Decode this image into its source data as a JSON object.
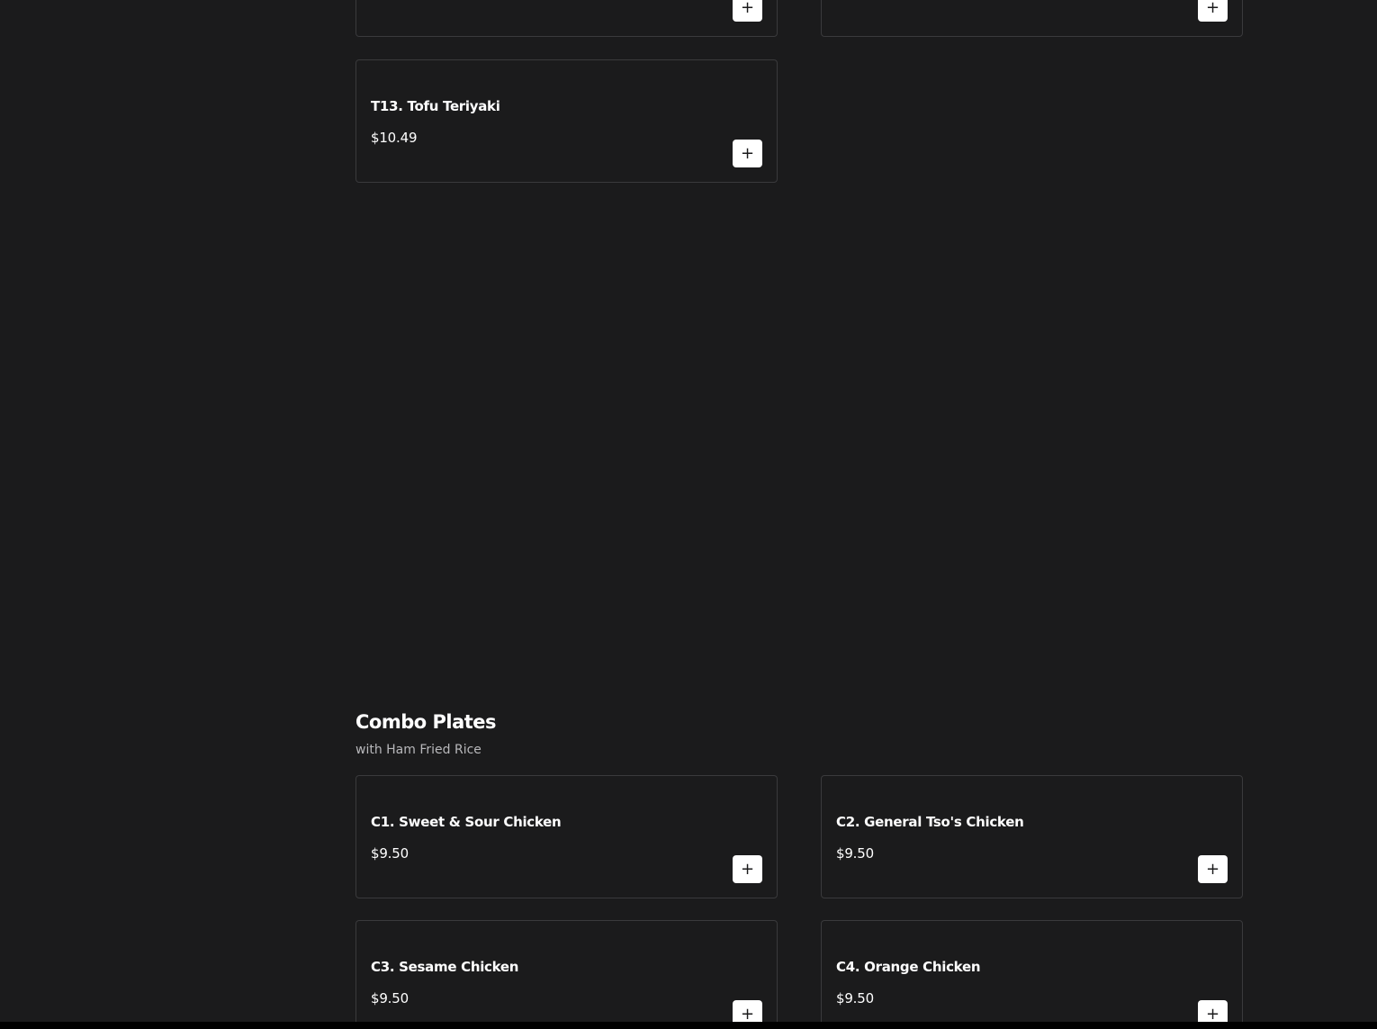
{
  "top_section": {
    "items": [
      {
        "name": "",
        "price": "",
        "add_icon": "plus-icon",
        "add_label": "+"
      },
      {
        "name": "",
        "price": "",
        "add_icon": "plus-icon",
        "add_label": "+"
      },
      {
        "name": "T13. Tofu Teriyaki",
        "price": "$10.49",
        "add_icon": "plus-icon",
        "add_label": "+"
      }
    ]
  },
  "combo_section": {
    "title": "Combo Plates",
    "subtitle": "with Ham Fried Rice",
    "items": [
      {
        "name": "C1. Sweet & Sour Chicken",
        "price": "$9.50",
        "add_icon": "plus-icon",
        "add_label": "+"
      },
      {
        "name": "C2. General Tso's Chicken",
        "price": "$9.50",
        "add_icon": "plus-icon",
        "add_label": "+"
      },
      {
        "name": "C3. Sesame Chicken",
        "price": "$9.50",
        "add_icon": "plus-icon",
        "add_label": "+"
      },
      {
        "name": "C4. Orange Chicken",
        "price": "$9.50",
        "add_icon": "plus-icon",
        "add_label": "+"
      }
    ]
  },
  "colors": {
    "background": "#1b1b1c",
    "card_border": "#3a3a3c",
    "button_background": "#ffffff",
    "text_primary": "#ffffff",
    "text_secondary": "#b8b8bb"
  }
}
